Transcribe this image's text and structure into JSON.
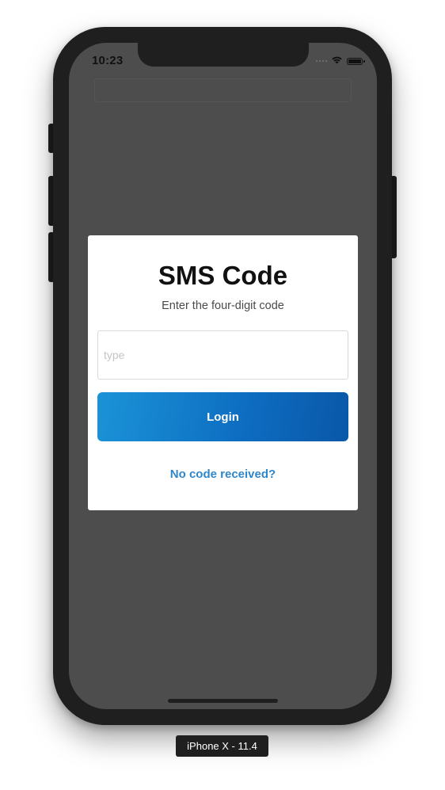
{
  "status_bar": {
    "time": "10:23"
  },
  "modal": {
    "title": "SMS Code",
    "subtitle": "Enter the four-digit code",
    "code_input": {
      "value": "",
      "placeholder": "type"
    },
    "login_label": "Login",
    "no_code_link": "No code received?"
  },
  "simulator": {
    "device_label": "iPhone X - 11.4"
  },
  "icons": {
    "signal": "cellular-signal-icon",
    "wifi": "wifi-icon",
    "battery": "battery-icon"
  },
  "colors": {
    "screen_overlay": "#4d4d4d",
    "button_gradient_start": "#1b93d8",
    "button_gradient_end": "#0a57a8",
    "link": "#2f86c8",
    "device_frame": "#1f1f1f"
  }
}
